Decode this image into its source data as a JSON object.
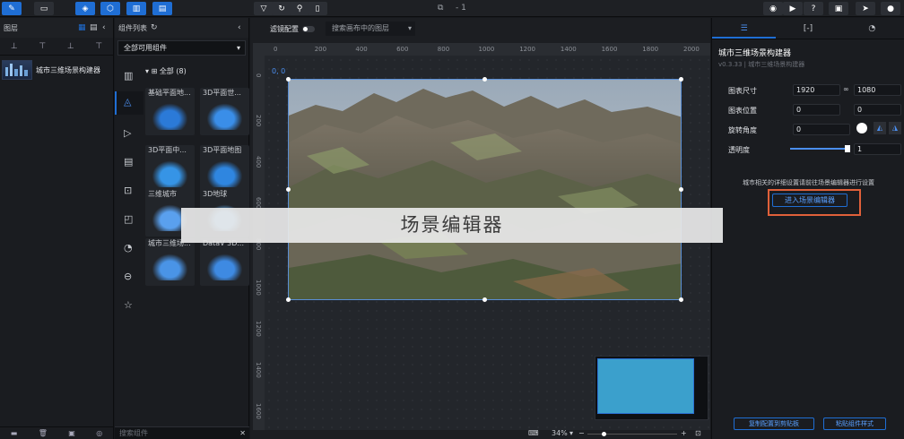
{
  "topbar": {
    "page_counter": "- 1"
  },
  "layers": {
    "title": "图层",
    "items": [
      {
        "label": "城市三维场景构建器"
      }
    ]
  },
  "components": {
    "title": "组件列表",
    "filter_value": "全部可用组件",
    "category_label": "全部 (8)",
    "tiles": [
      {
        "label": "基础平面地..."
      },
      {
        "label": "3D平面世..."
      },
      {
        "label": "3D平面中..."
      },
      {
        "label": "3D平面地图"
      },
      {
        "label": "三维城市"
      },
      {
        "label": "3D地球"
      },
      {
        "label": "城市三维场..."
      },
      {
        "label": "DataV 3D..."
      }
    ],
    "search_placeholder": "搜索组件"
  },
  "canvas": {
    "filter_label": "滤镜配置",
    "layer_search_placeholder": "搜索画布中的图层",
    "origin_label": "0, 0",
    "h_ruler_ticks": [
      "0",
      "200",
      "400",
      "600",
      "800",
      "1000",
      "1200",
      "1400",
      "1600",
      "1800",
      "2000"
    ],
    "v_ruler_ticks": [
      "0",
      "200",
      "400",
      "600",
      "800",
      "1000",
      "1200",
      "1400",
      "1600"
    ],
    "zoom": "34%",
    "overlay_caption": "场景编辑器"
  },
  "props": {
    "title": "城市三维场景构建器",
    "version": "v0.3.33 | 城市三维场景构建器",
    "size_label": "图表尺寸",
    "width": "1920",
    "height": "1080",
    "position_label": "图表位置",
    "pos_x": "0",
    "pos_y": "0",
    "rotation_label": "旋转角度",
    "rotation": "0",
    "opacity_label": "透明度",
    "opacity": "1",
    "hint_text": "城市相关的详细设置请前往场景编辑器进行设置",
    "enter_editor_label": "进入场景编辑器",
    "copy_config_label": "复制配置到剪贴板",
    "paste_style_label": "粘贴组件样式"
  },
  "colors": {
    "accent": "#1f6ed4",
    "highlight": "#e0603a",
    "thumb": "#3ba0cc"
  }
}
